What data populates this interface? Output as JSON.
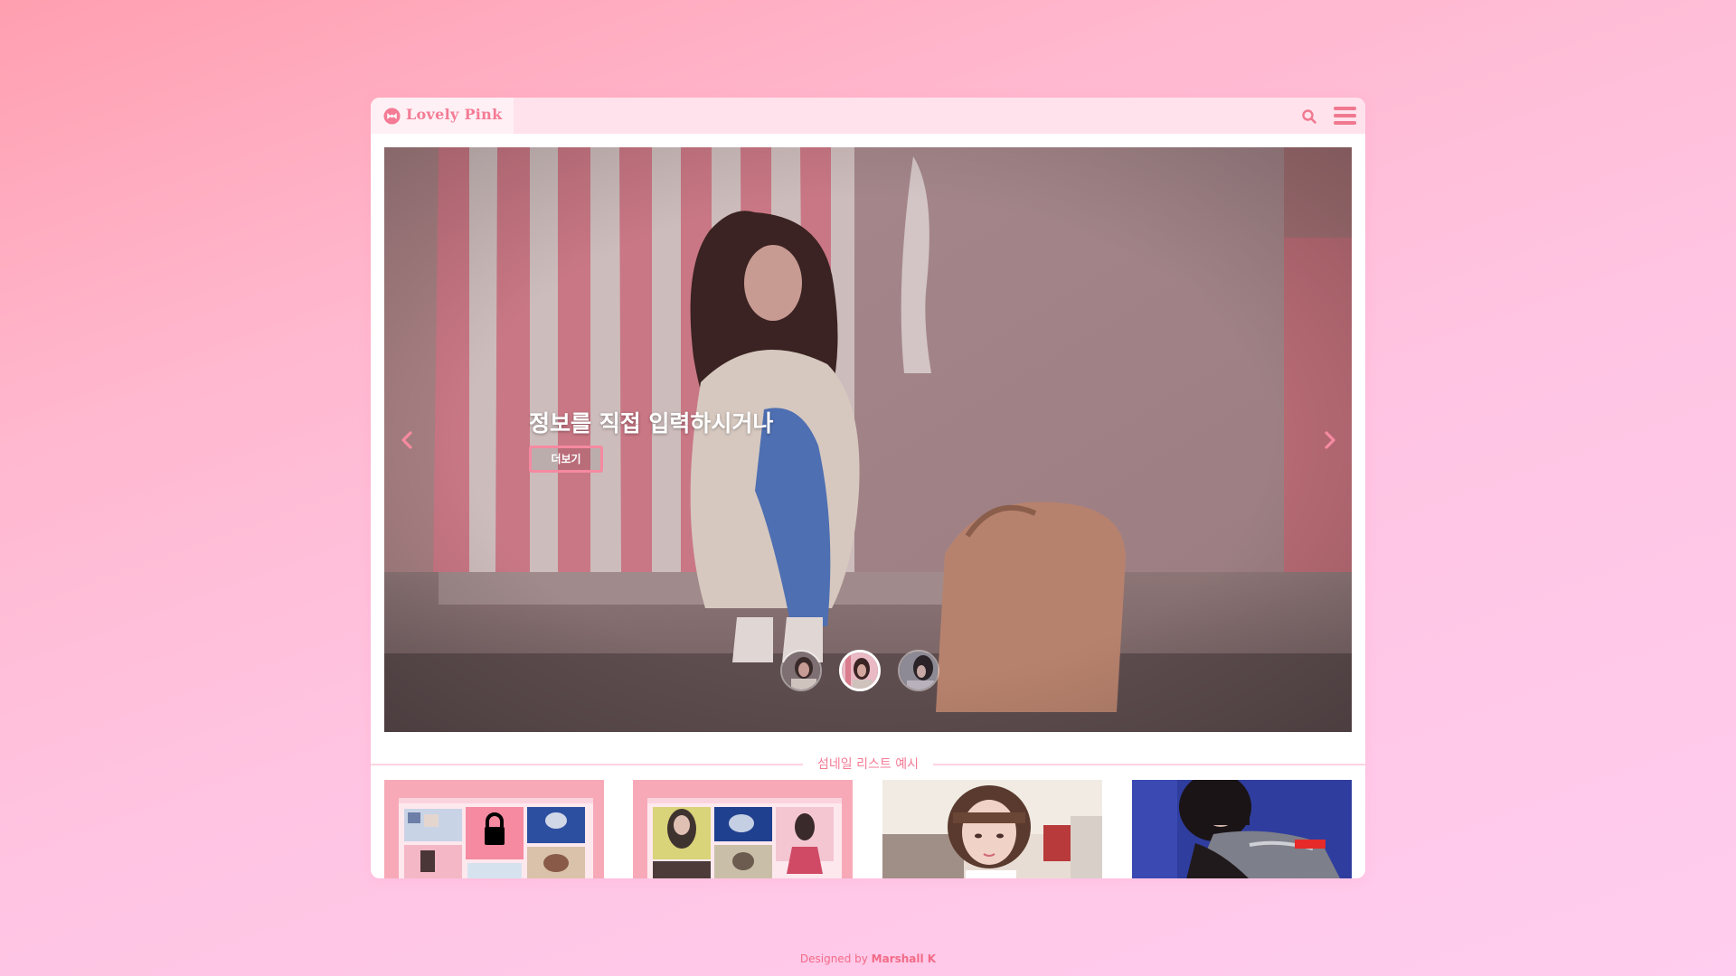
{
  "header": {
    "logo_text": "Lovely Pink",
    "logo_icon": "bow-icon",
    "search_icon": "search-icon",
    "menu_icon": "hamburger-menu-icon"
  },
  "hero": {
    "title": "정보를 직접 입력하시거나",
    "button_label": "더보기",
    "prev_icon": "chevron-left-icon",
    "next_icon": "chevron-right-icon",
    "active_slide": 2,
    "slide_count": 3
  },
  "thumbnails": {
    "section_title": "섬네일 리스트 예시",
    "count": 4
  },
  "footer": {
    "prefix": "Designed by ",
    "author": "Marshall K"
  },
  "colors": {
    "accent": "#f47b95",
    "header_bg": "#ffe2ec",
    "page_gradient_start": "#ff9fb0",
    "page_gradient_end": "#ffcdef"
  }
}
